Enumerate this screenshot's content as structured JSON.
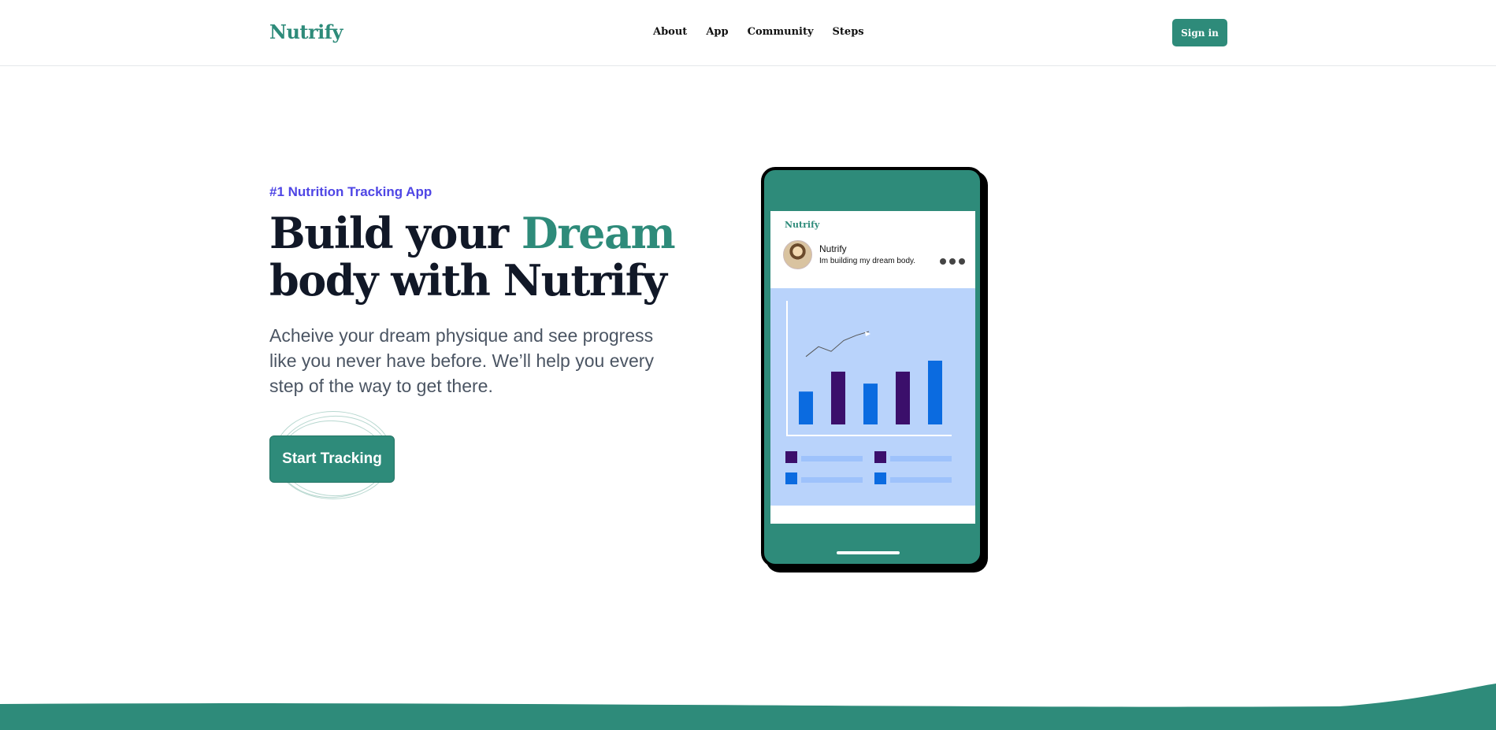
{
  "nav": {
    "logo": "Nutrify",
    "links": [
      "About",
      "App",
      "Community",
      "Steps"
    ],
    "signin_label": "Sign in"
  },
  "hero": {
    "eyebrow": "#1 Nutrition Tracking App",
    "headline_part1": "Build your ",
    "headline_accent": "Dream",
    "headline_part2": "body with Nutrify",
    "subtext": "Acheive your dream physique and see progress like you never have before. We’ll help you every step of the way to get there.",
    "cta_label": "Start Tracking"
  },
  "phone": {
    "app_logo": "Nutrify",
    "post_name": "Nutrify",
    "post_text": "Im building my dream body.",
    "chart_bars": [
      {
        "value": 0.33,
        "color": "#0b6be0"
      },
      {
        "value": 0.53,
        "color": "#3b0f6b"
      },
      {
        "value": 0.41,
        "color": "#0b6be0"
      },
      {
        "value": 0.53,
        "color": "#3b0f6b"
      },
      {
        "value": 0.64,
        "color": "#0b6be0"
      }
    ],
    "trend_line": [
      0.22,
      0.43,
      0.33,
      0.56,
      0.67,
      0.75
    ],
    "legend_items": [
      {
        "color": "#3b0f6b"
      },
      {
        "color": "#3b0f6b"
      },
      {
        "color": "#0b6be0"
      },
      {
        "color": "#0b6be0"
      }
    ]
  },
  "colors": {
    "brand": "#2e8b7a",
    "eyebrow": "#4f46e5",
    "heading": "#111827",
    "body": "#4b5563",
    "chart_bg": "#b9d3fb"
  }
}
